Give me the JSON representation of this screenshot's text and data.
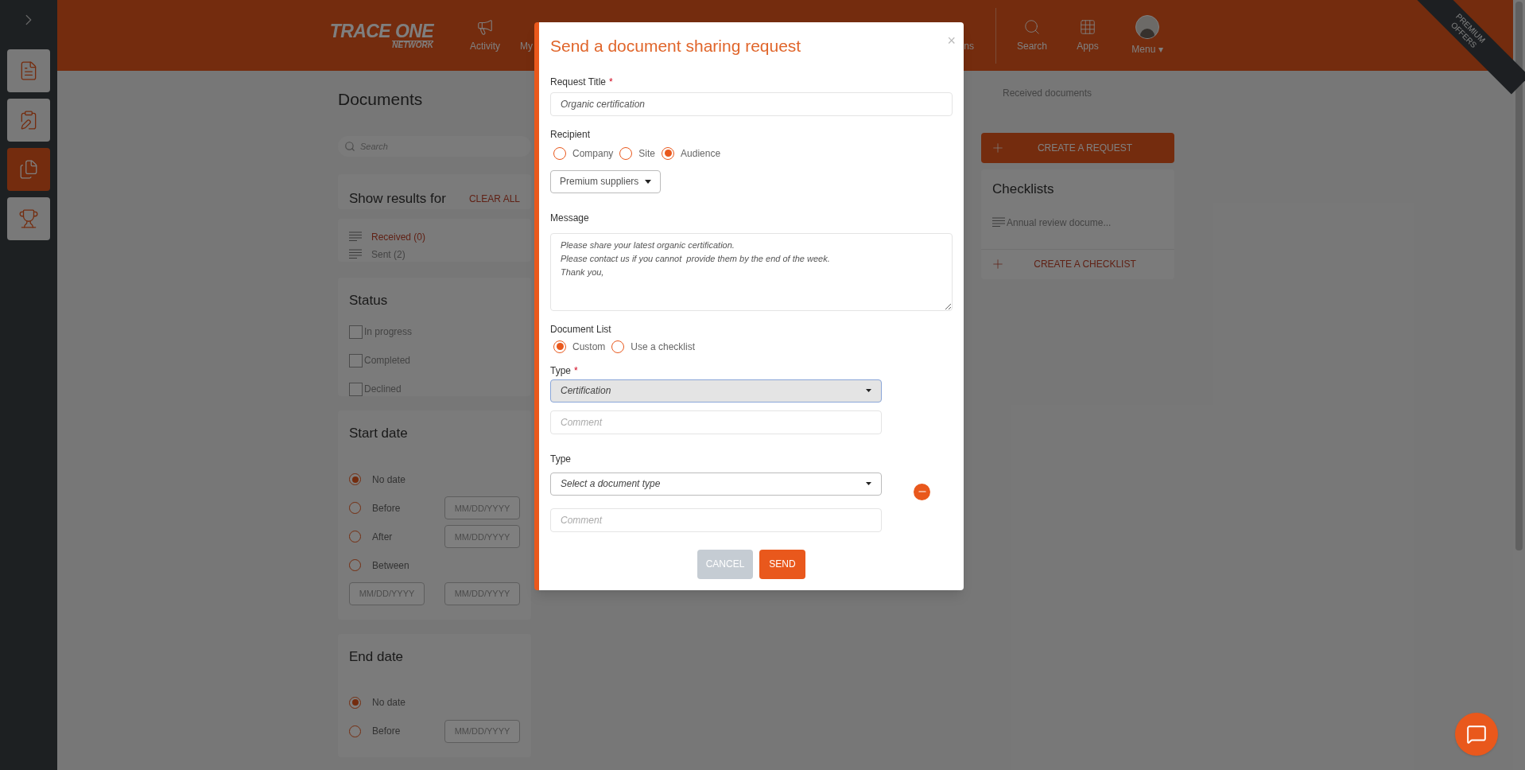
{
  "sidebar": {
    "items": [
      {
        "selected": false
      },
      {
        "selected": false
      },
      {
        "selected": true
      },
      {
        "selected": false
      }
    ]
  },
  "header": {
    "logo": {
      "name": "TRACE ONE",
      "tagline": "NETWORK"
    },
    "nav": [
      {
        "label": "Activity"
      },
      {
        "label": "My"
      }
    ],
    "nav_cut": "ns",
    "tools": [
      {
        "label": "Search"
      },
      {
        "label": "Apps"
      },
      {
        "label": "Menu",
        "caret": "▾"
      }
    ],
    "ribbon": [
      "PREMIUM",
      "OFFERS"
    ]
  },
  "page": {
    "title": "Documents",
    "search": {
      "placeholder": "Search"
    },
    "show_results": {
      "title": "Show results for",
      "clear": "CLEAR ALL"
    },
    "folders": [
      {
        "label": "Received (0)",
        "selected": true
      },
      {
        "label": "Sent (2)",
        "selected": false
      }
    ],
    "status": {
      "title": "Status",
      "options": [
        {
          "label": "In progress",
          "checked": false
        },
        {
          "label": "Completed",
          "checked": false
        },
        {
          "label": "Declined",
          "checked": false
        }
      ]
    },
    "start_date": {
      "title": "Start date",
      "options": [
        {
          "label": "No date",
          "selected": true
        },
        {
          "label": "Before",
          "selected": false,
          "fields": [
            {
              "placeholder": "MM/DD/YYYY"
            }
          ]
        },
        {
          "label": "After",
          "selected": false,
          "fields": [
            {
              "placeholder": "MM/DD/YYYY"
            }
          ]
        },
        {
          "label": "Between",
          "selected": false,
          "range": [
            {
              "placeholder": "MM/DD/YYYY"
            },
            {
              "placeholder": "MM/DD/YYYY"
            }
          ]
        }
      ]
    },
    "end_date": {
      "title": "End date",
      "options": [
        {
          "label": "No date",
          "selected": true
        },
        {
          "label": "Before",
          "selected": false,
          "fields": [
            {
              "placeholder": "MM/DD/YYYY"
            }
          ]
        }
      ]
    },
    "tabs": [
      {
        "label": "Received documents",
        "selected": false
      }
    ],
    "create_request": "CREATE A REQUEST",
    "checklists": {
      "title": "Checklists",
      "items": [
        "Annual review docume..."
      ],
      "create": "CREATE A CHECKLIST"
    }
  },
  "modal": {
    "title": "Send a document sharing request",
    "close": "×",
    "request_title": {
      "label": "Request Title",
      "required_mark": "*",
      "value": "Organic certification"
    },
    "recipient": {
      "label": "Recipient",
      "options": [
        {
          "label": "Company",
          "selected": false
        },
        {
          "label": "Site",
          "selected": false
        },
        {
          "label": "Audience",
          "selected": true
        }
      ],
      "audience": "Premium suppliers"
    },
    "message": {
      "label": "Message",
      "value": "Please share your latest organic certification.\nPlease contact us if you cannot  provide them by the end of the week.\nThank you,"
    },
    "document_list": {
      "label": "Document List",
      "options": [
        {
          "label": "Custom",
          "selected": true
        },
        {
          "label": "Use a checklist",
          "selected": false
        }
      ]
    },
    "documents": [
      {
        "label": "Type",
        "required_mark": "*",
        "value": "Certification",
        "focused": true,
        "comment": {
          "placeholder": "Comment"
        },
        "removable": false
      },
      {
        "label": "Type",
        "placeholder": "Select a document type",
        "focused": false,
        "comment": {
          "placeholder": "Comment"
        },
        "removable": true
      }
    ],
    "buttons": [
      {
        "label": "CANCEL",
        "kind": "secondary"
      },
      {
        "label": "SEND",
        "kind": "primary"
      }
    ]
  }
}
